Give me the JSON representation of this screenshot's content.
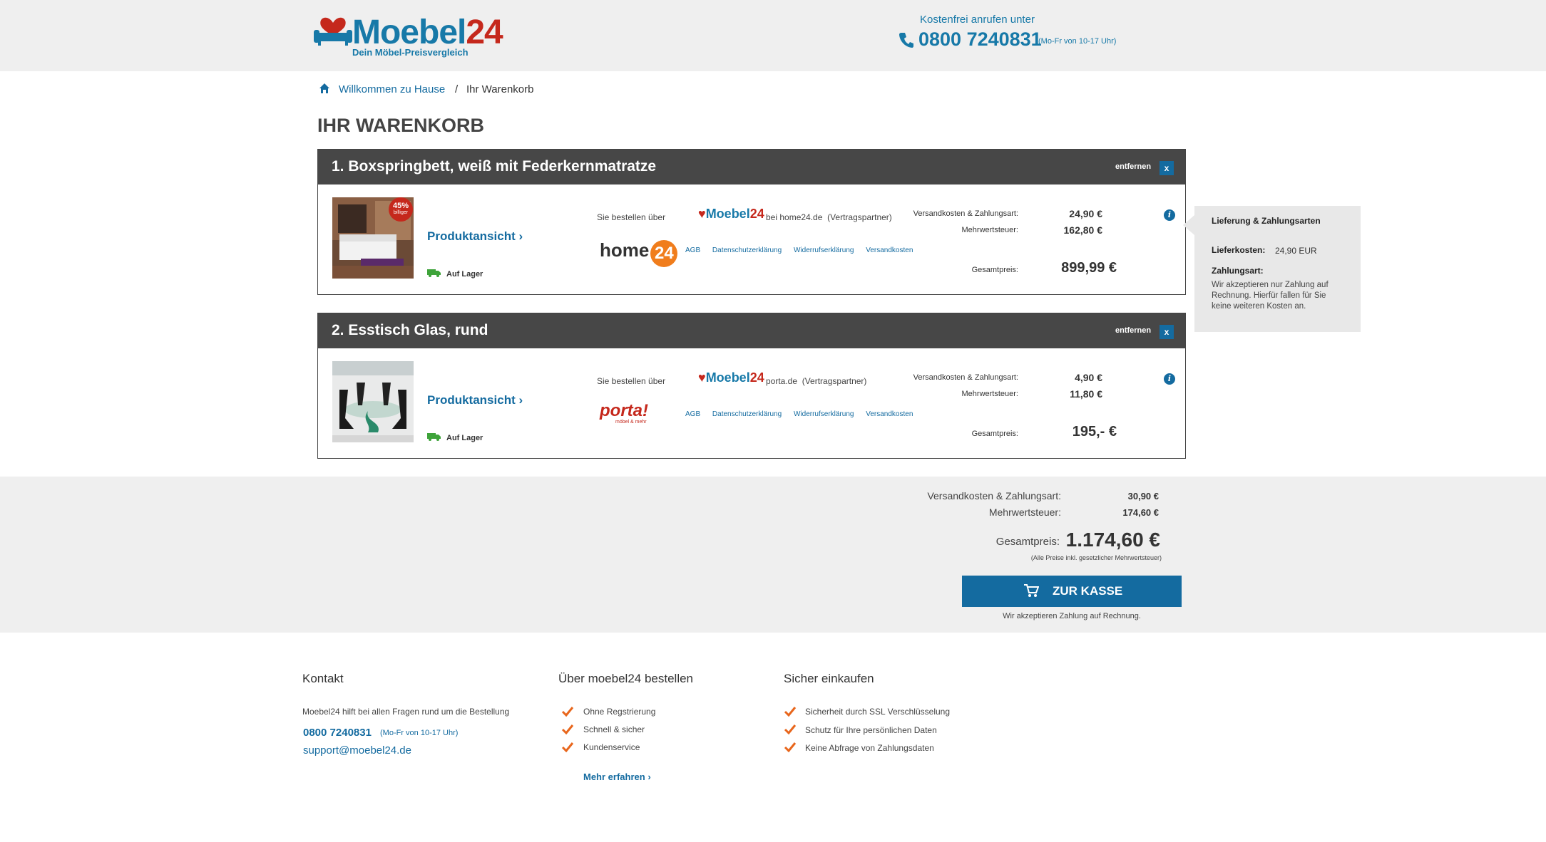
{
  "header": {
    "logo_main": "Moebel",
    "logo_num": "24",
    "logo_sub": "Dein Möbel-Preisvergleich",
    "hotline_label": "Kostenfrei anrufen unter",
    "hotline_number": "0800 7240831",
    "hotline_hours": "(Mo-Fr von 10-17 Uhr)"
  },
  "breadcrumb": {
    "home": "Willkommen zu Hause",
    "separator": "/",
    "current": "Ihr Warenkorb"
  },
  "page_title": "IHR WARENKORB",
  "cart": {
    "remove_label": "entfernen",
    "remove_x": "x",
    "product_link": "Produktansicht",
    "stock": "Auf Lager",
    "order_via": "Sie bestellen über",
    "partner_suffix": "(Vertragspartner)",
    "links": [
      "AGB",
      "Datenschutzerklärung",
      "Widerrufserklärung",
      "Versandkosten"
    ],
    "shipping_label": "Versandkosten & Zahlungsart:",
    "vat_label": "Mehrwertsteuer:",
    "total_label": "Gesamtpreis:",
    "items": [
      {
        "title": "1.  Boxspringbett, weiß mit Federkernmatratze",
        "badge": "45%",
        "badge_sub": "billiger",
        "shop_prefix": "bei home24.de",
        "shop_logo": "home24",
        "shipping": "24,90 €",
        "vat": "162,80 €",
        "total": "899,99 €"
      },
      {
        "title": "2.  Esstisch Glas, rund",
        "shop_prefix": "porta.de",
        "shop_logo": "porta!",
        "shop_logo_sub": "möbel & mehr",
        "shipping": "4,90 €",
        "vat": "11,80 €",
        "total": "195,- €"
      }
    ]
  },
  "popover": {
    "title": "Lieferung & Zahlungsarten",
    "delivery_label": "Lieferkosten:",
    "delivery_value": "24,90 EUR",
    "payment_label": "Zahlungsart:",
    "payment_text": "Wir akzeptieren nur Zahlung auf Rechnung. Hierfür fallen für Sie keine weiteren Kosten an."
  },
  "summary": {
    "shipping_label": "Versandkosten & Zahlungsart:",
    "shipping": "30,90 €",
    "vat_label": "Mehrwertsteuer:",
    "vat": "174,60 €",
    "total_label": "Gesamtpreis:",
    "total": "1.174,60 €",
    "note": "(Alle Preise inkl. gesetzlicher Mehrwertsteuer)",
    "checkout": "ZUR KASSE",
    "payment_note": "Wir akzeptieren Zahlung auf Rechnung."
  },
  "footer": {
    "contact_title": "Kontakt",
    "contact_text": "Moebel24 hilft bei allen Fragen rund um die Bestellung",
    "phone": "0800 7240831",
    "hours": "(Mo-Fr von 10-17 Uhr)",
    "email": "support@moebel24.de",
    "order_title": "Über moebel24 bestellen",
    "order_points": [
      "Ohne Regstrierung",
      "Schnell & sicher",
      "Kundenservice"
    ],
    "more": "Mehr erfahren",
    "secure_title": "Sicher einkaufen",
    "secure_points": [
      "Sicherheit durch SSL Verschlüsselung",
      "Schutz für Ihre persönlichen Daten",
      "Keine Abfrage von Zahlungsdaten"
    ]
  },
  "colors": {
    "brand_blue": "#146ba0",
    "brand_red": "#c5281c",
    "header_bg": "#efefef",
    "item_header": "#474747",
    "check_orange": "#e8661c"
  },
  "icons": [
    "phone-icon",
    "home-icon",
    "truck-icon",
    "info-icon",
    "cart-icon",
    "check-icon",
    "chevron-right-icon"
  ]
}
